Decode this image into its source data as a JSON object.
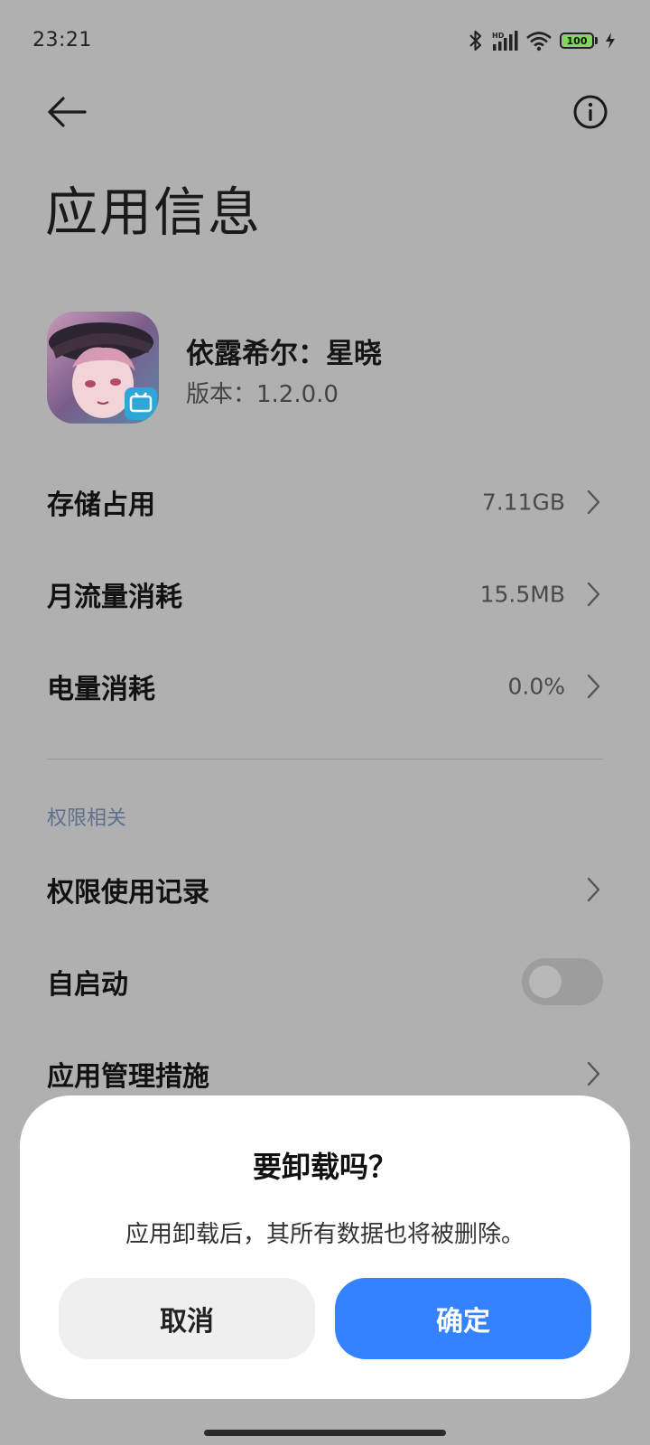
{
  "status_bar": {
    "time": "23:21",
    "battery_level": "100",
    "icons": [
      "bluetooth-icon",
      "signal-icon",
      "wifi-icon",
      "battery-icon",
      "charging-icon"
    ]
  },
  "header": {
    "title": "应用信息",
    "back_icon": "arrow-left-icon",
    "info_icon": "info-icon"
  },
  "app": {
    "name": "依露希尔：星晓",
    "version": "版本：1.2.0.0"
  },
  "rows": [
    {
      "label": "存储占用",
      "value": "7.11GB"
    },
    {
      "label": "月流量消耗",
      "value": "15.5MB"
    },
    {
      "label": "电量消耗",
      "value": "0.0%"
    }
  ],
  "permissions": {
    "section_title": "权限相关",
    "items": [
      {
        "label": "权限使用记录"
      },
      {
        "label": "自启动",
        "toggle_on": false
      },
      {
        "label": "应用管理措施"
      }
    ]
  },
  "dialog": {
    "title": "要卸载吗？",
    "message": "应用卸载后，其所有数据也将被删除。",
    "cancel_label": "取消",
    "confirm_label": "确定"
  },
  "colors": {
    "scrim_background": "#b0b0b0",
    "confirm_button": "#3482ff",
    "cancel_button": "#efefef",
    "battery_fill": "#7ed957"
  }
}
